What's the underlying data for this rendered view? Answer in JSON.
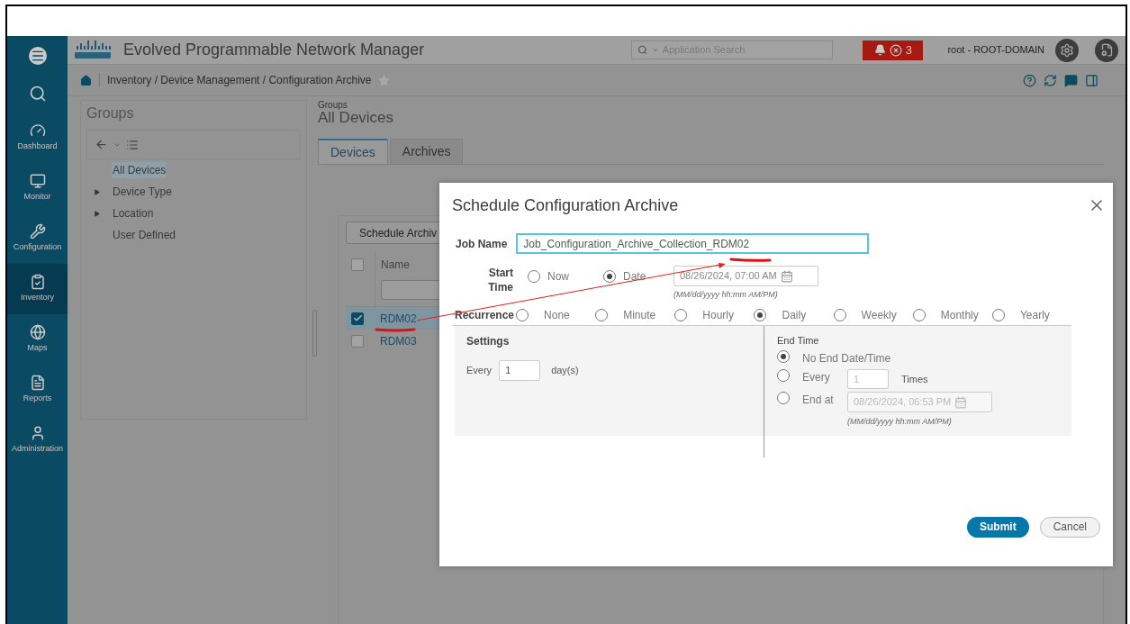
{
  "header": {
    "product": "Evolved Programmable Network Manager",
    "search": {
      "placeholder": "Application Search"
    },
    "alarm_count": "3",
    "user": "root - ROOT-DOMAIN"
  },
  "nav": [
    {
      "label": "Dashboard",
      "selected": false
    },
    {
      "label": "Monitor",
      "selected": false
    },
    {
      "label": "Configuration",
      "selected": false
    },
    {
      "label": "Inventory",
      "selected": true
    },
    {
      "label": "Maps",
      "selected": false
    },
    {
      "label": "Reports",
      "selected": false
    },
    {
      "label": "Administration",
      "selected": false
    }
  ],
  "breadcrumb": "Inventory / Device Management / Configuration Archive",
  "groups": {
    "title": "Groups",
    "items": [
      {
        "label": "All Devices",
        "selected": true,
        "expandable": false
      },
      {
        "label": "Device Type",
        "selected": false,
        "expandable": true
      },
      {
        "label": "Location",
        "selected": false,
        "expandable": true
      },
      {
        "label": "User Defined",
        "selected": false,
        "expandable": false
      }
    ]
  },
  "content": {
    "subtitle": "Groups",
    "title": "All Devices",
    "tabs": [
      {
        "label": "Devices",
        "selected": true
      },
      {
        "label": "Archives",
        "selected": false
      }
    ],
    "toolbar_button": "Schedule Archiv",
    "table": {
      "select_all_checked": false,
      "columns": [
        "Name"
      ],
      "rows": [
        {
          "name": "RDM02",
          "checked": true
        },
        {
          "name": "RDM03",
          "checked": false
        }
      ]
    }
  },
  "dialog": {
    "title": "Schedule Configuration Archive",
    "job_name": {
      "label": "Job Name",
      "value": "Job_Configuration_Archive_Collection_RDM02"
    },
    "start_time": {
      "label": "Start Time",
      "options": [
        {
          "label": "Now",
          "selected": false
        },
        {
          "label": "Date",
          "selected": true
        }
      ],
      "date": "08/26/2024, 07:00 AM",
      "hint": "(MM/dd/yyyy hh:mm AM/PM)"
    },
    "recurrence": {
      "label": "Recurrence",
      "options": [
        {
          "label": "None",
          "selected": false
        },
        {
          "label": "Minute",
          "selected": false
        },
        {
          "label": "Hourly",
          "selected": false
        },
        {
          "label": "Daily",
          "selected": true
        },
        {
          "label": "Weekly",
          "selected": false
        },
        {
          "label": "Monthly",
          "selected": false
        },
        {
          "label": "Yearly",
          "selected": false
        }
      ]
    },
    "settings": {
      "title": "Settings",
      "every_label": "Every",
      "every_value": "1",
      "unit": "day(s)"
    },
    "end_time": {
      "title": "End Time",
      "options": [
        {
          "kind": "plain",
          "label": "No End Date/Time",
          "selected": true
        },
        {
          "kind": "count",
          "label": "Every",
          "value": "1",
          "suffix": "Times",
          "selected": false
        },
        {
          "kind": "date",
          "label": "End at",
          "value": "08/26/2024, 06:53 PM",
          "hint": "(MM/dd/yyyy hh:mm AM/PM)",
          "selected": false
        }
      ]
    },
    "buttons": [
      "Submit",
      "Cancel"
    ]
  }
}
